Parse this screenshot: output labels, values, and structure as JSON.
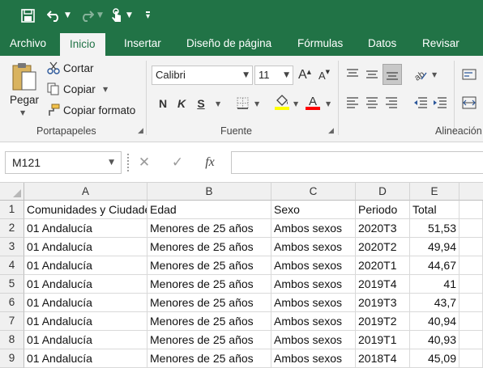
{
  "qat": {
    "save_icon": "save-icon",
    "undo_icon": "undo-icon",
    "redo_icon": "redo-icon",
    "touch_icon": "touch-mode-icon",
    "customize_icon": "customize-qat-icon"
  },
  "tabs": [
    {
      "label": "Archivo"
    },
    {
      "label": "Inicio"
    },
    {
      "label": "Insertar"
    },
    {
      "label": "Diseño de página"
    },
    {
      "label": "Fórmulas"
    },
    {
      "label": "Datos"
    },
    {
      "label": "Revisar"
    }
  ],
  "ribbon": {
    "clipboard": {
      "paste_label": "Pegar",
      "cut_label": "Cortar",
      "copy_label": "Copiar",
      "format_painter_label": "Copiar formato",
      "group_label": "Portapapeles"
    },
    "font": {
      "font_name": "Calibri",
      "font_size": "11",
      "bold": "N",
      "italic": "K",
      "underline": "S",
      "grow": "A",
      "shrink": "A",
      "fill_color": "#ffff00",
      "font_color": "#ff0000",
      "group_label": "Fuente"
    },
    "alignment": {
      "group_label": "Alineación"
    }
  },
  "formula_bar": {
    "name_box": "M121",
    "cancel": "✕",
    "enter": "✓",
    "fx": "fx",
    "value": ""
  },
  "grid": {
    "columns": [
      "A",
      "B",
      "C",
      "D",
      "E"
    ],
    "rows": [
      "1",
      "2",
      "3",
      "4",
      "5",
      "6",
      "7",
      "8",
      "9"
    ],
    "header_row": [
      "Comunidades y Ciudades Autónomas",
      "Edad",
      "Sexo",
      "Periodo",
      "Total"
    ],
    "data": [
      [
        "01 Andalucía",
        "Menores de 25 años",
        "Ambos sexos",
        "2020T3",
        "51,53"
      ],
      [
        "01 Andalucía",
        "Menores de 25 años",
        "Ambos sexos",
        "2020T2",
        "49,94"
      ],
      [
        "01 Andalucía",
        "Menores de 25 años",
        "Ambos sexos",
        "2020T1",
        "44,67"
      ],
      [
        "01 Andalucía",
        "Menores de 25 años",
        "Ambos sexos",
        "2019T4",
        "41"
      ],
      [
        "01 Andalucía",
        "Menores de 25 años",
        "Ambos sexos",
        "2019T3",
        "43,7"
      ],
      [
        "01 Andalucía",
        "Menores de 25 años",
        "Ambos sexos",
        "2019T2",
        "40,94"
      ],
      [
        "01 Andalucía",
        "Menores de 25 años",
        "Ambos sexos",
        "2019T1",
        "40,93"
      ],
      [
        "01 Andalucía",
        "Menores de 25 años",
        "Ambos sexos",
        "2018T4",
        "45,09"
      ]
    ]
  },
  "colors": {
    "brand": "#217346",
    "ribbon_bg": "#f3f3f3"
  }
}
